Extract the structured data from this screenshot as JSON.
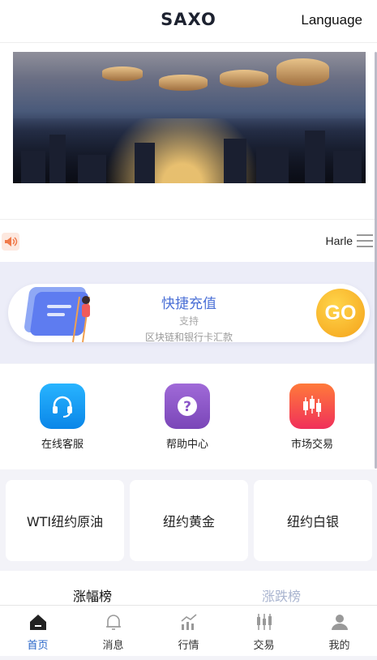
{
  "header": {
    "brand": "SAXO",
    "language": "Language"
  },
  "notice": {
    "text": "Harle"
  },
  "recharge": {
    "title": "快捷充值",
    "subtitle": "支持",
    "description": "区块链和银行卡汇款",
    "go_label": "GO"
  },
  "shortcuts": [
    {
      "label": "在线客服",
      "icon": "headset-icon",
      "color": "#1a9df0"
    },
    {
      "label": "帮助中心",
      "icon": "help-icon",
      "color": "#8a55c8"
    },
    {
      "label": "市场交易",
      "icon": "candlestick-icon",
      "color": "#f04a4a"
    }
  ],
  "markets": [
    {
      "label": "WTI纽约原油"
    },
    {
      "label": "纽约黄金"
    },
    {
      "label": "纽约白银"
    }
  ],
  "rank_tabs": [
    {
      "label": "涨幅榜",
      "active": true
    },
    {
      "label": "涨跌榜",
      "active": false
    }
  ],
  "tabbar": [
    {
      "label": "首页",
      "icon": "home-icon",
      "active": true
    },
    {
      "label": "消息",
      "icon": "bell-icon",
      "active": false
    },
    {
      "label": "行情",
      "icon": "chart-icon",
      "active": false
    },
    {
      "label": "交易",
      "icon": "trade-icon",
      "active": false
    },
    {
      "label": "我的",
      "icon": "user-icon",
      "active": false
    }
  ],
  "colors": {
    "accent": "#2a67c9",
    "go": "#f4a21a",
    "recharge_title": "#4a6fd6"
  }
}
